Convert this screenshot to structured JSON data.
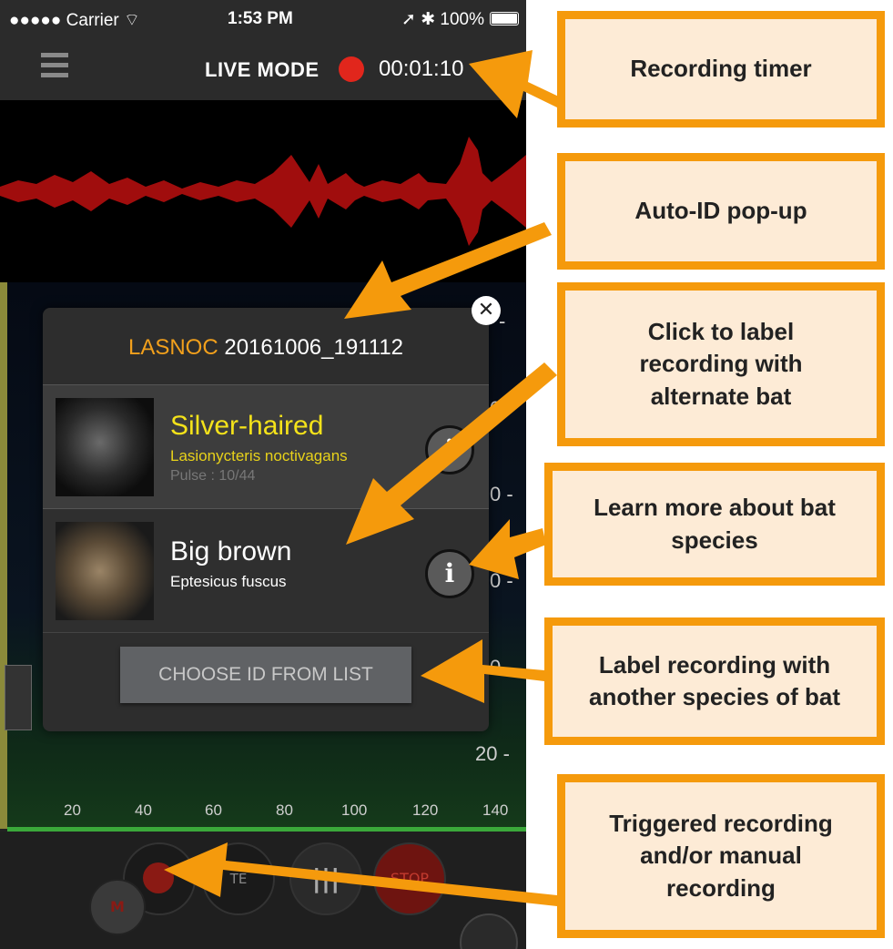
{
  "statusbar": {
    "carrier": "●●●●● Carrier ⌔",
    "time": "1:53 PM",
    "battery": "➚ ✱ 100%"
  },
  "navbar": {
    "mode": "LIVE MODE",
    "timer": "00:01:10"
  },
  "spectrogram": {
    "freq_labels": [
      "-",
      "0  -",
      "0  -",
      "0  -",
      "0  -",
      "20  -"
    ],
    "x_ticks": [
      "20",
      "40",
      "60",
      "80",
      "100",
      "120",
      "140"
    ]
  },
  "popup": {
    "code": "LASNOC",
    "filename": "20161006_191112",
    "species": [
      {
        "name": "Silver-haired",
        "latin": "Lasionycteris noctivagans",
        "pulse": "Pulse : 10/44"
      },
      {
        "name": "Big brown",
        "latin": "Eptesicus fuscus"
      }
    ],
    "info_glyph": "i",
    "choose_label": "CHOOSE ID FROM LIST"
  },
  "controls": {
    "m_label": "M",
    "stop_label": "STOP",
    "trigger_label": "TE"
  },
  "callouts": {
    "timer": "Recording timer",
    "popup": "Auto-ID pop-up",
    "label": "Click to label recording with alternate bat",
    "learn": "Learn more about bat species",
    "another": "Label recording with another species of bat",
    "triggered": "Triggered recording and/or manual recording"
  },
  "colors": {
    "accent": "#f59a0c",
    "record_red": "#e1261c",
    "species_yellow": "#f4e21a"
  }
}
